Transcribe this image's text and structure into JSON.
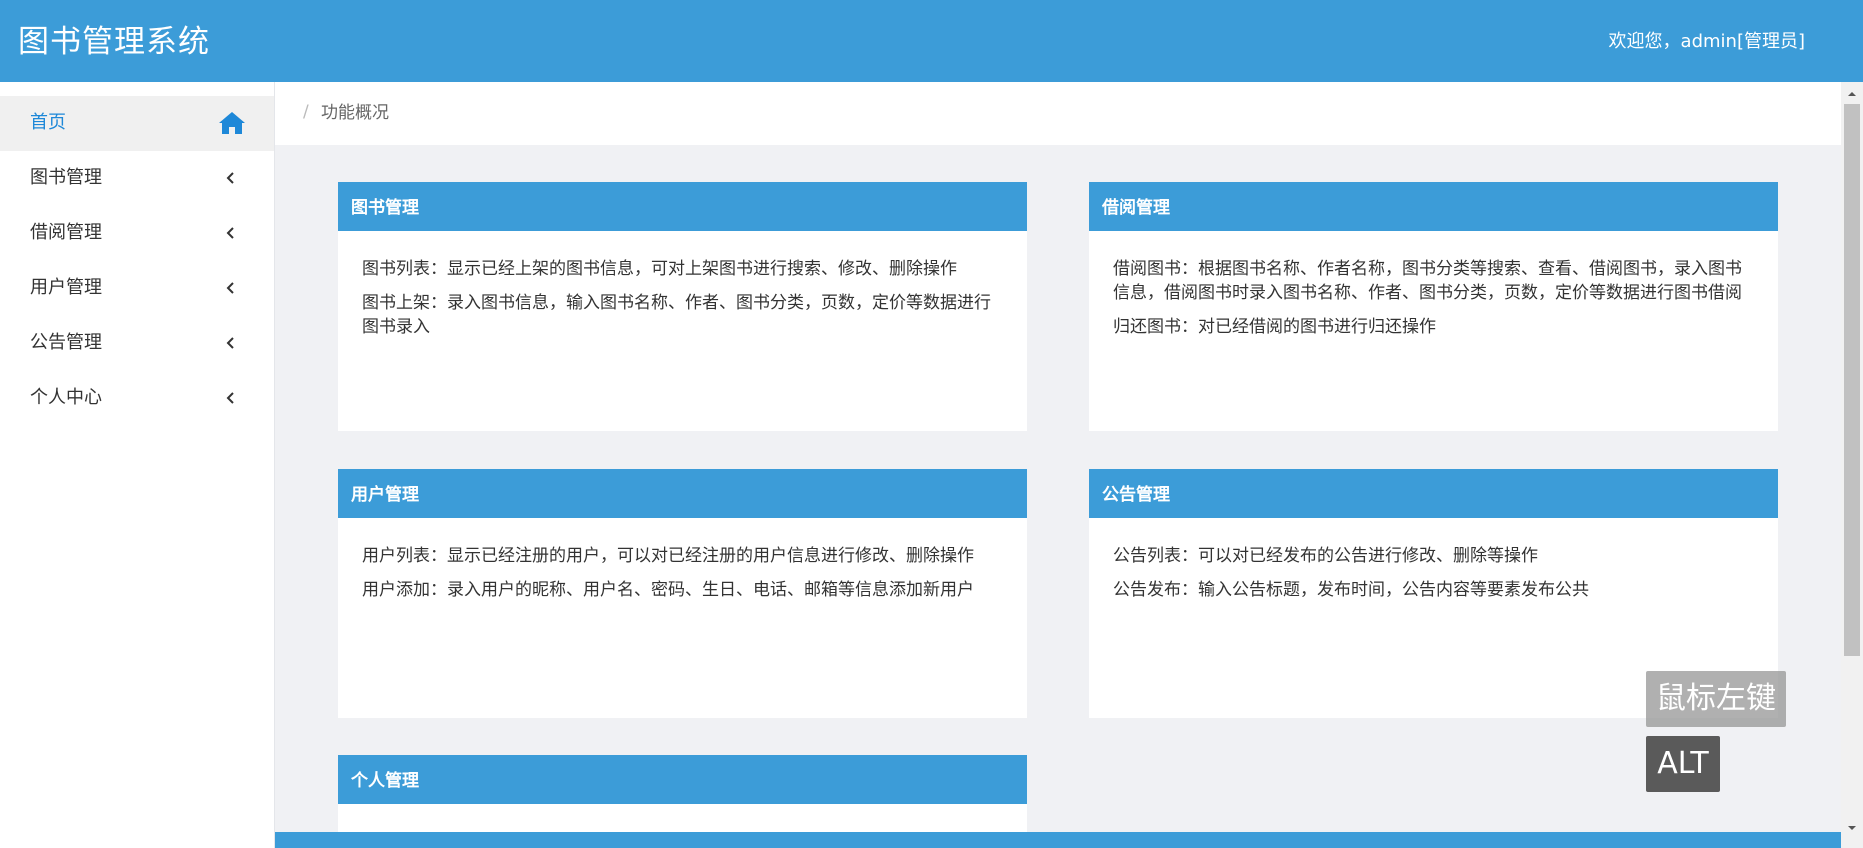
{
  "header": {
    "title": "图书管理系统",
    "welcome": "欢迎您，admin[管理员]",
    "bg_color": "#3c9cd8"
  },
  "sidebar": {
    "items": [
      {
        "label": "首页",
        "icon": "home-icon",
        "active": true
      },
      {
        "label": "图书管理",
        "icon": "chevron-left-icon"
      },
      {
        "label": "借阅管理",
        "icon": "chevron-left-icon"
      },
      {
        "label": "用户管理",
        "icon": "chevron-left-icon"
      },
      {
        "label": "公告管理",
        "icon": "chevron-left-icon"
      },
      {
        "label": "个人中心",
        "icon": "chevron-left-icon"
      }
    ],
    "active_color": "#1e88d8"
  },
  "breadcrumb": {
    "separator": "/",
    "current": "功能概况"
  },
  "cards": [
    {
      "title": "图书管理",
      "lines": [
        "图书列表：显示已经上架的图书信息，可对上架图书进行搜索、修改、删除操作",
        "图书上架：录入图书信息，输入图书名称、作者、图书分类，页数，定价等数据进行图书录入"
      ]
    },
    {
      "title": "借阅管理",
      "lines": [
        "借阅图书：根据图书名称、作者名称，图书分类等搜索、查看、借阅图书，录入图书信息，借阅图书时录入图书名称、作者、图书分类，页数，定价等数据进行图书借阅",
        "归还图书：对已经借阅的图书进行归还操作"
      ]
    },
    {
      "title": "用户管理",
      "lines": [
        "用户列表：显示已经注册的用户，可以对已经注册的用户信息进行修改、删除操作",
        "用户添加：录入用户的昵称、用户名、密码、生日、电话、邮箱等信息添加新用户"
      ]
    },
    {
      "title": "公告管理",
      "lines": [
        "公告列表：可以对已经发布的公告进行修改、删除等操作",
        "公告发布：输入公告标题，发布时间，公告内容等要素发布公共"
      ]
    },
    {
      "title": "个人管理",
      "lines": []
    }
  ],
  "overlays": {
    "mouse_label": "鼠标左键",
    "key_label": "ALT"
  }
}
